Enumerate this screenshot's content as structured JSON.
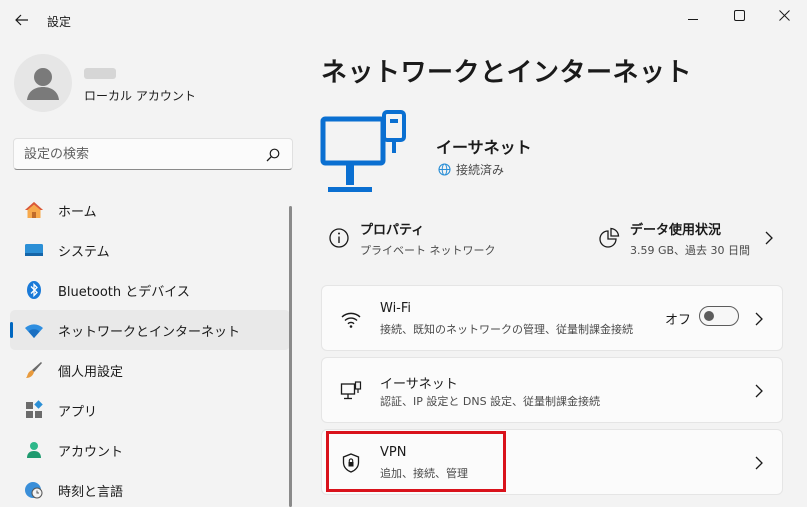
{
  "window": {
    "title": "設定"
  },
  "profile": {
    "account_type": "ローカル アカウント"
  },
  "search": {
    "placeholder": "設定の検索"
  },
  "nav": {
    "items": [
      {
        "label": "ホーム",
        "icon": "home-icon"
      },
      {
        "label": "システム",
        "icon": "system-icon"
      },
      {
        "label": "Bluetooth とデバイス",
        "icon": "bluetooth-icon"
      },
      {
        "label": "ネットワークとインターネット",
        "icon": "wifi-icon",
        "active": true
      },
      {
        "label": "個人用設定",
        "icon": "brush-icon"
      },
      {
        "label": "アプリ",
        "icon": "apps-icon"
      },
      {
        "label": "アカウント",
        "icon": "person-icon"
      },
      {
        "label": "時刻と言語",
        "icon": "globe-clock-icon"
      }
    ]
  },
  "main": {
    "title": "ネットワークとインターネット",
    "hero": {
      "name": "イーサネット",
      "status": "接続済み"
    },
    "properties": {
      "title": "プロパティ",
      "sub": "プライベート ネットワーク"
    },
    "data_usage": {
      "title": "データ使用状況",
      "sub": "3.59 GB、過去 30 日間"
    },
    "cards": [
      {
        "title": "Wi-Fi",
        "sub": "接続、既知のネットワークの管理、従量制課金接続",
        "toggle_label": "オフ",
        "toggle_on": false
      },
      {
        "title": "イーサネット",
        "sub": "認証、IP 設定と DNS 設定、従量制課金接続"
      },
      {
        "title": "VPN",
        "sub": "追加、接続、管理"
      }
    ]
  },
  "colors": {
    "accent": "#0067c0",
    "highlight": "#d9121b"
  }
}
